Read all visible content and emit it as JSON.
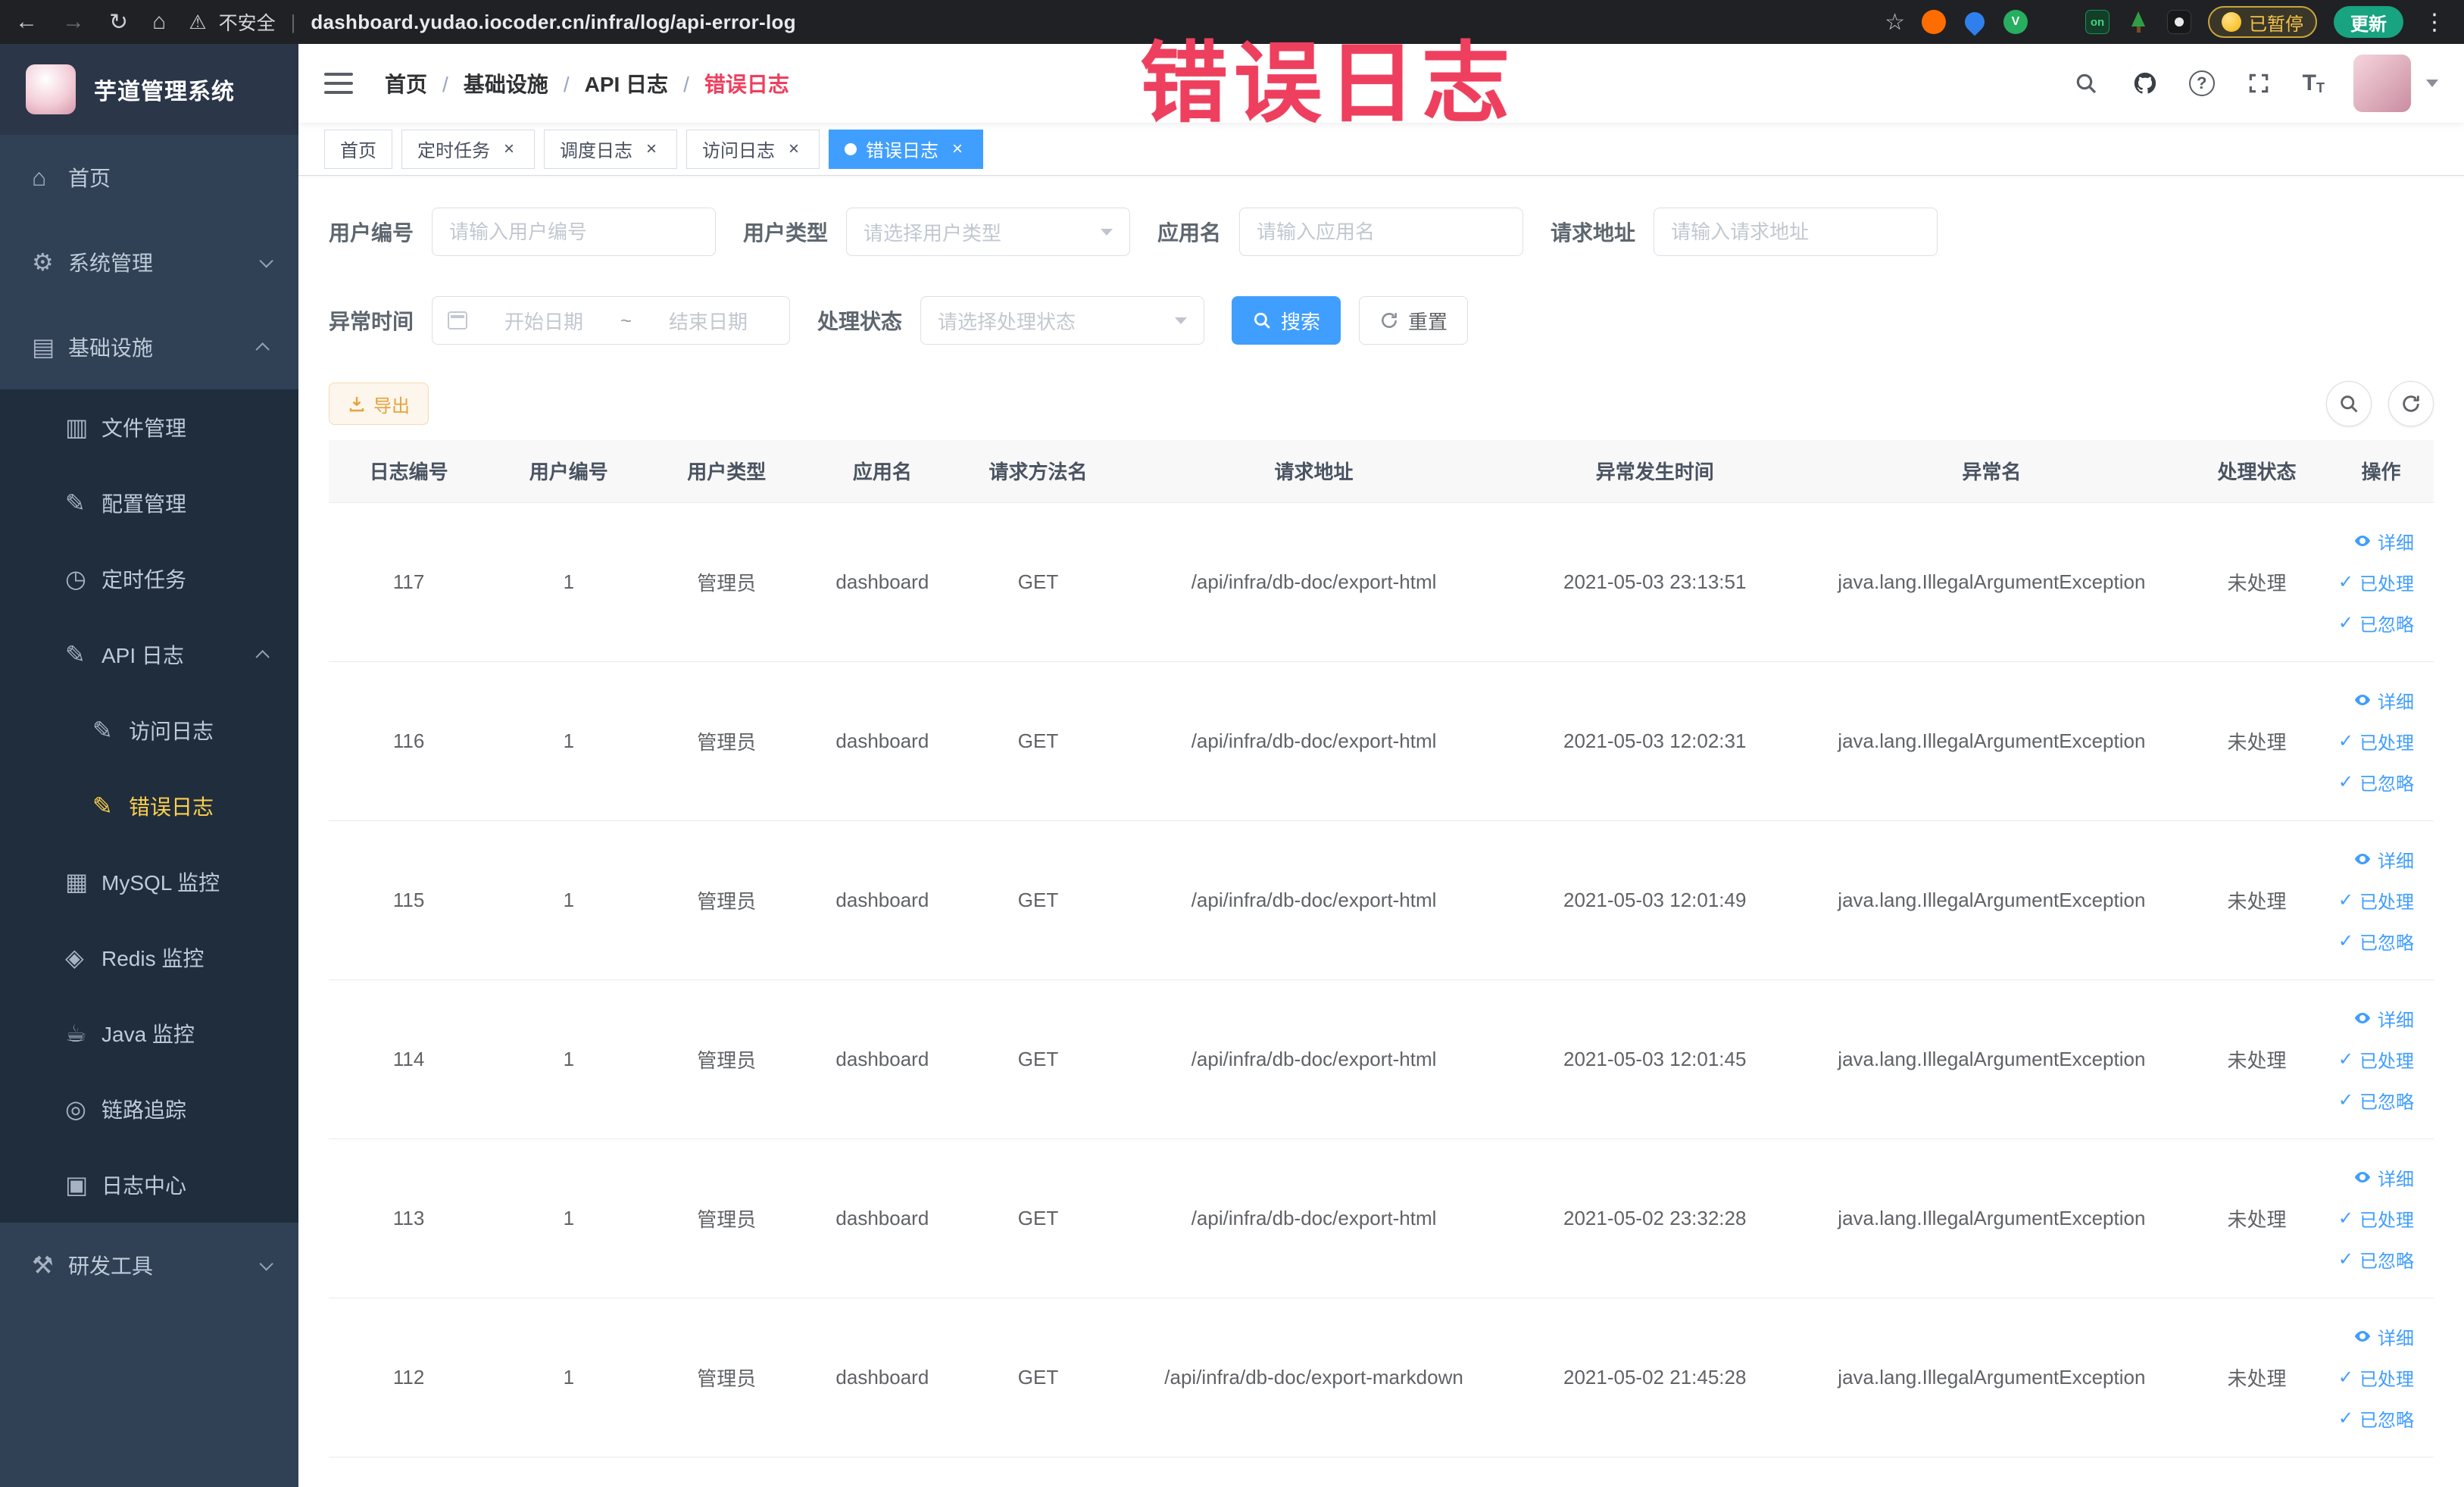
{
  "colors": {
    "accent": "#409eff",
    "annotation_red": "#ee3f5e",
    "sidebar_bg": "#304156",
    "sidebar_submenu_bg": "#1f2d3d",
    "sidebar_active_text": "#ffd04b",
    "export_button_text": "#e6a23c",
    "table_header_bg": "#f8f8f9"
  },
  "annotation": {
    "text": "错误日志"
  },
  "browser": {
    "security_label": "不安全",
    "url": "dashboard.yudao.iocoder.cn/infra/log/api-error-log",
    "paused_button": "已暂停",
    "update_button": "更新",
    "extension_badge": "on"
  },
  "sidebar": {
    "logo_title": "芋道管理系统",
    "items": [
      {
        "label": "首页",
        "glyph": "⌂",
        "icon": "home-icon",
        "level": 1
      },
      {
        "label": "系统管理",
        "glyph": "⚙",
        "icon": "gear-icon",
        "level": 1,
        "group": true
      },
      {
        "label": "基础设施",
        "glyph": "▤",
        "icon": "infrastructure-icon",
        "level": 1,
        "group": true,
        "expanded": true
      },
      {
        "label": "文件管理",
        "glyph": "▥",
        "icon": "file-manage-icon",
        "level": 2
      },
      {
        "label": "配置管理",
        "glyph": "✎",
        "icon": "config-manage-icon",
        "level": 2
      },
      {
        "label": "定时任务",
        "glyph": "◷",
        "icon": "scheduled-task-icon",
        "level": 2
      },
      {
        "label": "API 日志",
        "glyph": "✎",
        "icon": "api-log-icon",
        "level": 2,
        "group": true,
        "expanded": true
      },
      {
        "label": "访问日志",
        "glyph": "✎",
        "icon": "access-log-icon",
        "level": 3
      },
      {
        "label": "错误日志",
        "glyph": "✎",
        "icon": "error-log-icon",
        "level": 3,
        "active": true
      },
      {
        "label": "MySQL 监控",
        "glyph": "▦",
        "icon": "mysql-monitor-icon",
        "level": 2
      },
      {
        "label": "Redis 监控",
        "glyph": "◈",
        "icon": "redis-monitor-icon",
        "level": 2
      },
      {
        "label": "Java 监控",
        "glyph": "☕",
        "icon": "java-monitor-icon",
        "level": 2
      },
      {
        "label": "链路追踪",
        "glyph": "◎",
        "icon": "trace-icon",
        "level": 2
      },
      {
        "label": "日志中心",
        "glyph": "▣",
        "icon": "log-center-icon",
        "level": 2
      },
      {
        "label": "研发工具",
        "glyph": "⚒",
        "icon": "dev-tools-icon",
        "level": 1,
        "group": true
      }
    ]
  },
  "navbar": {
    "breadcrumb": [
      {
        "label": "首页"
      },
      {
        "label": "基础设施"
      },
      {
        "label": "API 日志"
      },
      {
        "label": "错误日志",
        "current": true
      }
    ]
  },
  "tabs": [
    {
      "label": "首页"
    },
    {
      "label": "定时任务",
      "closable": true
    },
    {
      "label": "调度日志",
      "closable": true
    },
    {
      "label": "访问日志",
      "closable": true
    },
    {
      "label": "错误日志",
      "closable": true,
      "active": true
    }
  ],
  "filters": {
    "user_id": {
      "label": "用户编号",
      "placeholder": "请输入用户编号"
    },
    "user_type": {
      "label": "用户类型",
      "placeholder": "请选择用户类型"
    },
    "app_name": {
      "label": "应用名",
      "placeholder": "请输入应用名"
    },
    "request_url": {
      "label": "请求地址",
      "placeholder": "请输入请求地址"
    },
    "exception_time": {
      "label": "异常时间",
      "start_placeholder": "开始日期",
      "separator": "~",
      "end_placeholder": "结束日期"
    },
    "process_status": {
      "label": "处理状态",
      "placeholder": "请选择处理状态"
    },
    "search_button": "搜索",
    "reset_button": "重置"
  },
  "toolbar": {
    "export_button": "导出"
  },
  "table": {
    "columns": [
      "日志编号",
      "用户编号",
      "用户类型",
      "应用名",
      "请求方法名",
      "请求地址",
      "异常发生时间",
      "异常名",
      "处理状态",
      "操作"
    ],
    "action_labels": {
      "detail": "详细",
      "processed": "已处理",
      "ignored": "已忽略"
    },
    "rows": [
      {
        "id": "117",
        "user_id": "1",
        "user_type": "管理员",
        "app_name": "dashboard",
        "method": "GET",
        "url": "/api/infra/db-doc/export-html",
        "time": "2021-05-03 23:13:51",
        "exception": "java.lang.IllegalArgumentException",
        "status": "未处理"
      },
      {
        "id": "116",
        "user_id": "1",
        "user_type": "管理员",
        "app_name": "dashboard",
        "method": "GET",
        "url": "/api/infra/db-doc/export-html",
        "time": "2021-05-03 12:02:31",
        "exception": "java.lang.IllegalArgumentException",
        "status": "未处理"
      },
      {
        "id": "115",
        "user_id": "1",
        "user_type": "管理员",
        "app_name": "dashboard",
        "method": "GET",
        "url": "/api/infra/db-doc/export-html",
        "time": "2021-05-03 12:01:49",
        "exception": "java.lang.IllegalArgumentException",
        "status": "未处理"
      },
      {
        "id": "114",
        "user_id": "1",
        "user_type": "管理员",
        "app_name": "dashboard",
        "method": "GET",
        "url": "/api/infra/db-doc/export-html",
        "time": "2021-05-03 12:01:45",
        "exception": "java.lang.IllegalArgumentException",
        "status": "未处理"
      },
      {
        "id": "113",
        "user_id": "1",
        "user_type": "管理员",
        "app_name": "dashboard",
        "method": "GET",
        "url": "/api/infra/db-doc/export-html",
        "time": "2021-05-02 23:32:28",
        "exception": "java.lang.IllegalArgumentException",
        "status": "未处理"
      },
      {
        "id": "112",
        "user_id": "1",
        "user_type": "管理员",
        "app_name": "dashboard",
        "method": "GET",
        "url": "/api/infra/db-doc/export-markdown",
        "time": "2021-05-02 21:45:28",
        "exception": "java.lang.IllegalArgumentException",
        "status": "未处理"
      }
    ]
  }
}
